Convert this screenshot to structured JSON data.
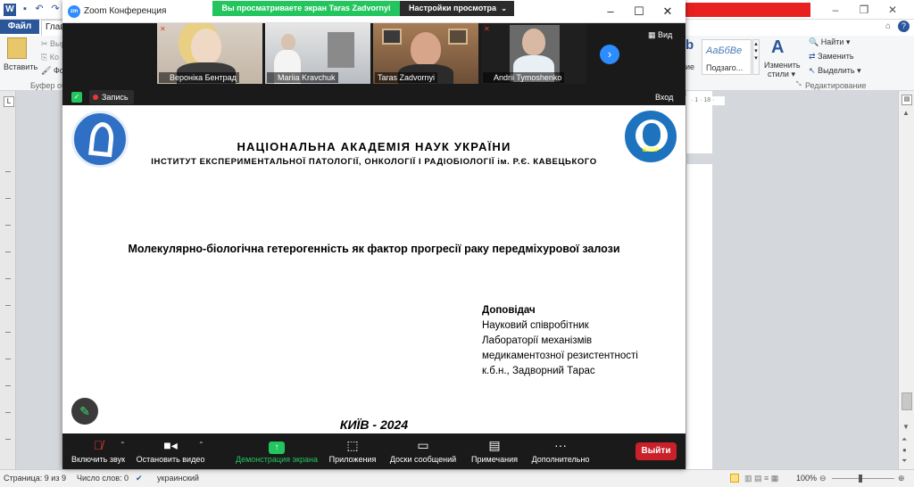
{
  "word": {
    "file_tab": "Файл",
    "home_tab": "Глав",
    "ribbon": {
      "paste_label": "Вставить",
      "cut_label": "Выр",
      "copy_label": "Ко",
      "format_label": "Фо",
      "clipboard_group": "Буфер об",
      "style_preview": "АаБбВе",
      "style_name": "Подзаго...",
      "style_left": "ие",
      "change_styles": "Изменить",
      "styles_label": "стили",
      "find_label": "Найти",
      "replace_label": "Заменить",
      "select_label": "Выделить",
      "editing_group": "Редактирование"
    },
    "ruler_marks": "· 1 · 18 ·",
    "status": {
      "page": "Страница: 9 из 9",
      "words": "Число слов: 0",
      "language": "украинский",
      "zoom": "100%"
    }
  },
  "zoom": {
    "title": "Zoom Конференция",
    "sharing_banner": "Вы просматриваете экран Taras Zadvornyi",
    "view_options": "Настройки просмотра",
    "view_button": "Вид",
    "recording": "Запись",
    "exit": "Вход",
    "participants": [
      {
        "name": "Вероніка Бентрад",
        "muted": true
      },
      {
        "name": "Mariia Kravchuk",
        "muted": false
      },
      {
        "name": "Taras Zadvornyi",
        "muted": false
      },
      {
        "name": "Andrii Tymoshenko",
        "muted": true
      }
    ],
    "toolbar": {
      "unmute": "Включить звук",
      "stop_video": "Остановить видео",
      "share_screen": "Демонстрация экрана",
      "apps": "Приложения",
      "whiteboards": "Доски сообщений",
      "notes": "Примечания",
      "more": "Дополнительно",
      "leave": "Выйти"
    }
  },
  "slide": {
    "academy": "НАЦІОНАЛЬНА  АКАДЕМІЯ  НАУК  УКРАЇНИ",
    "institute": "ІНСТИТУТ  ЕКСПЕРИМЕНТАЛЬНОЇ ПАТОЛОГІЇ,  ОНКОЛОГІЇ  І  РАДІОБІОЛОГІЇ  ім. Р.Є.  КАВЕЦЬКОГО",
    "right_logo_text": "ІЕПОР",
    "title": "Молекулярно-біологічна гетерогенність як фактор прогресії раку передміхурової залози",
    "reporter_heading": "Доповідач",
    "reporter_lines": [
      "Науковий співробітник",
      "Лабораторії механізмів",
      "медикаментозної резистентності",
      "к.б.н., Задворний Тарас"
    ],
    "city_year": "КИЇВ - 2024"
  }
}
